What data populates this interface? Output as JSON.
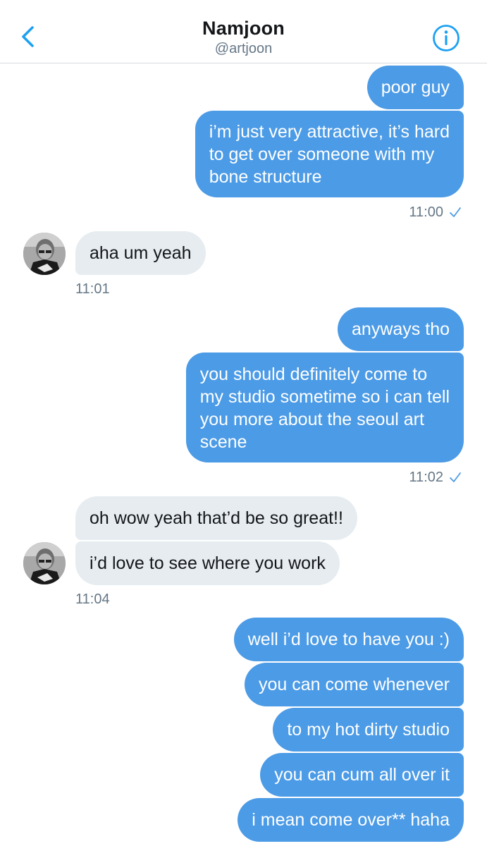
{
  "header": {
    "name": "Namjoon",
    "handle": "@artjoon",
    "back_icon": "chevron-left-icon",
    "info_icon": "info-icon",
    "accent_color": "#1da1f2"
  },
  "colors": {
    "outgoing_bubble": "#4c9be6",
    "incoming_bubble": "#e6ecf0",
    "timestamp": "#657786"
  },
  "messages": [
    {
      "from": "me",
      "text": "poor guy"
    },
    {
      "from": "me",
      "lines": [
        "i’m just very attractive, it’s hard",
        "to get over someone with my",
        "bone structure"
      ],
      "time": "11:00",
      "read": true
    },
    {
      "from": "them",
      "text": "aha um yeah",
      "time": "11:01"
    },
    {
      "from": "me",
      "text": "anyways tho"
    },
    {
      "from": "me",
      "lines": [
        "you should definitely come to",
        "my studio sometime so i can tell",
        "you more about the seoul art",
        "scene"
      ],
      "time": "11:02",
      "read": true
    },
    {
      "from": "them",
      "text": "oh wow yeah that’d be so great!!"
    },
    {
      "from": "them",
      "text": "i’d love to see where you work",
      "time": "11:04"
    },
    {
      "from": "me",
      "text": "well i’d love to have you :)"
    },
    {
      "from": "me",
      "text": "you can come whenever"
    },
    {
      "from": "me",
      "text": "to my hot dirty studio"
    },
    {
      "from": "me",
      "text": "you can cum all over it"
    },
    {
      "from": "me",
      "text": "i mean come over** haha"
    }
  ]
}
